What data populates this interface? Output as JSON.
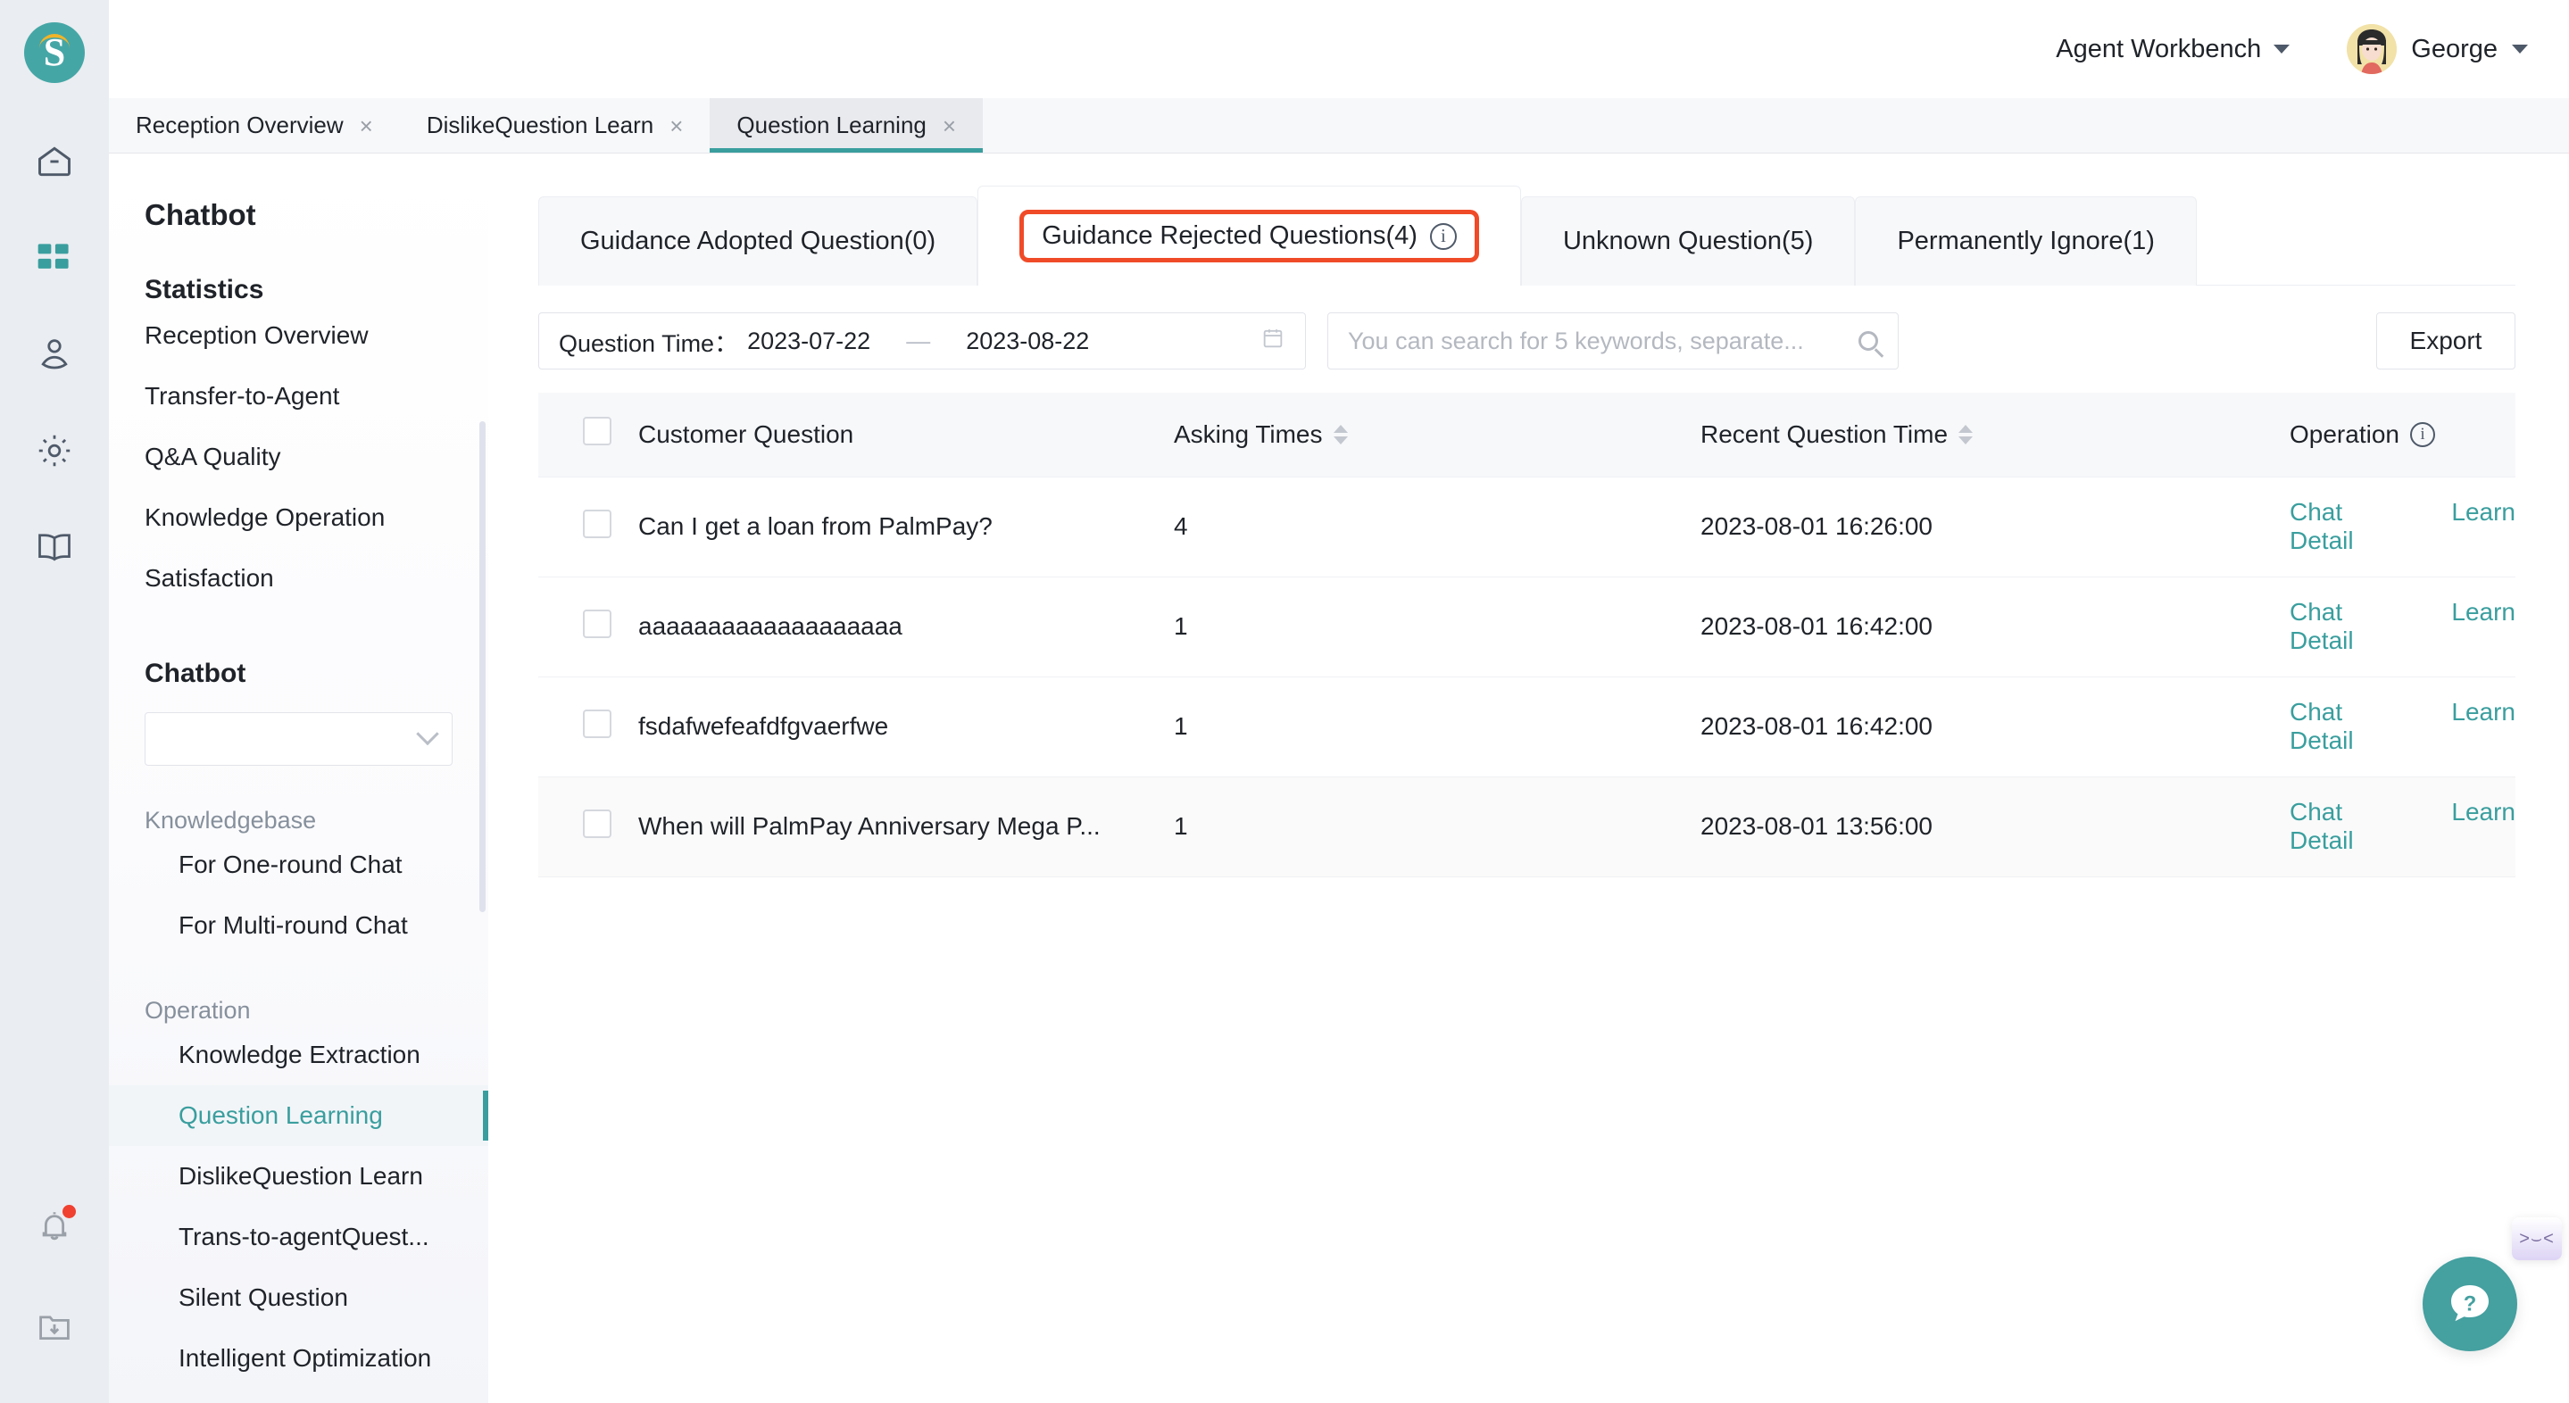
{
  "header": {
    "workbench_label": "Agent Workbench",
    "user_name": "George",
    "workbench_icon": "chevron-down-icon",
    "user_icon": "chevron-down-icon"
  },
  "browser_tabs": [
    {
      "label": "Reception Overview",
      "close": "×",
      "active": false
    },
    {
      "label": "DislikeQuestion Learn",
      "close": "×",
      "active": false
    },
    {
      "label": "Question Learning",
      "close": "×",
      "active": true
    }
  ],
  "rail": {
    "logo_letter": "S",
    "icons": [
      {
        "name": "home-icon"
      },
      {
        "name": "apps-grid-icon",
        "active": true
      },
      {
        "name": "user-location-icon"
      },
      {
        "name": "gear-icon"
      },
      {
        "name": "book-icon"
      }
    ],
    "bottom_icons": [
      {
        "name": "bell-icon",
        "badge": true
      },
      {
        "name": "download-folder-icon"
      }
    ]
  },
  "sidebar": {
    "title": "Chatbot",
    "statistics_heading": "Statistics",
    "statistics_items": [
      "Reception Overview",
      "Transfer-to-Agent",
      "Q&A Quality",
      "Knowledge Operation",
      "Satisfaction"
    ],
    "chatbot_heading": "Chatbot",
    "select_value": "",
    "knowledgebase_heading": "Knowledgebase",
    "knowledgebase_items": [
      "For One-round Chat",
      "For Multi-round Chat"
    ],
    "operation_heading": "Operation",
    "operation_items": [
      {
        "label": "Knowledge Extraction",
        "selected": false
      },
      {
        "label": "Question Learning",
        "selected": true
      },
      {
        "label": "DislikeQuestion Learn",
        "selected": false
      },
      {
        "label": "Trans-to-agentQuest...",
        "selected": false
      },
      {
        "label": "Silent Question",
        "selected": false
      },
      {
        "label": "Intelligent Optimization",
        "selected": false
      }
    ]
  },
  "main": {
    "card_tabs": [
      {
        "label": "Guidance Adopted Question(0)",
        "active": false,
        "highlighted": false,
        "info": false
      },
      {
        "label": "Guidance Rejected Questions(4)",
        "active": true,
        "highlighted": true,
        "info": true
      },
      {
        "label": "Unknown Question(5)",
        "active": false,
        "highlighted": false,
        "info": false
      },
      {
        "label": "Permanently Ignore(1)",
        "active": false,
        "highlighted": false,
        "info": false
      }
    ],
    "filters": {
      "date_label": "Question Time：",
      "date_start": "2023-07-22",
      "date_sep": "—",
      "date_end": "2023-08-22",
      "calendar_icon": "calendar-icon",
      "search_value": "",
      "search_placeholder": "You can search for 5 keywords, separate...",
      "search_icon": "search-icon",
      "export_label": "Export"
    },
    "table": {
      "columns": [
        {
          "label": "",
          "sortable": false
        },
        {
          "label": "Customer Question",
          "sortable": false
        },
        {
          "label": "Asking Times",
          "sortable": true
        },
        {
          "label": "Recent Question Time",
          "sortable": true
        },
        {
          "label": "Operation",
          "sortable": false,
          "info": true
        }
      ],
      "rows": [
        {
          "question": "Can I get a loan from PalmPay?",
          "asking_times": "4",
          "recent_time": "2023-08-01 16:26:00",
          "op_chat": "Chat Detail",
          "op_learn": "Learn",
          "hovered": false
        },
        {
          "question": "aaaaaaaaaaaaaaaaaaa",
          "asking_times": "1",
          "recent_time": "2023-08-01 16:42:00",
          "op_chat": "Chat Detail",
          "op_learn": "Learn",
          "hovered": false
        },
        {
          "question": "fsdafwefeafdfgvaerfwe",
          "asking_times": "1",
          "recent_time": "2023-08-01 16:42:00",
          "op_chat": "Chat Detail",
          "op_learn": "Learn",
          "hovered": false
        },
        {
          "question": "When will PalmPay Anniversary Mega P...",
          "asking_times": "1",
          "recent_time": "2023-08-01 13:56:00",
          "op_chat": "Chat Detail",
          "op_learn": "Learn",
          "hovered": true
        }
      ]
    },
    "floaters": {
      "kaomoji": ">⌣<",
      "help_icon": "help-question-icon"
    }
  },
  "colors": {
    "brand_teal": "#3a9e9e",
    "highlight_red": "#f04b28",
    "rail_bg": "#eaedf1",
    "badge_red": "#f04030"
  }
}
